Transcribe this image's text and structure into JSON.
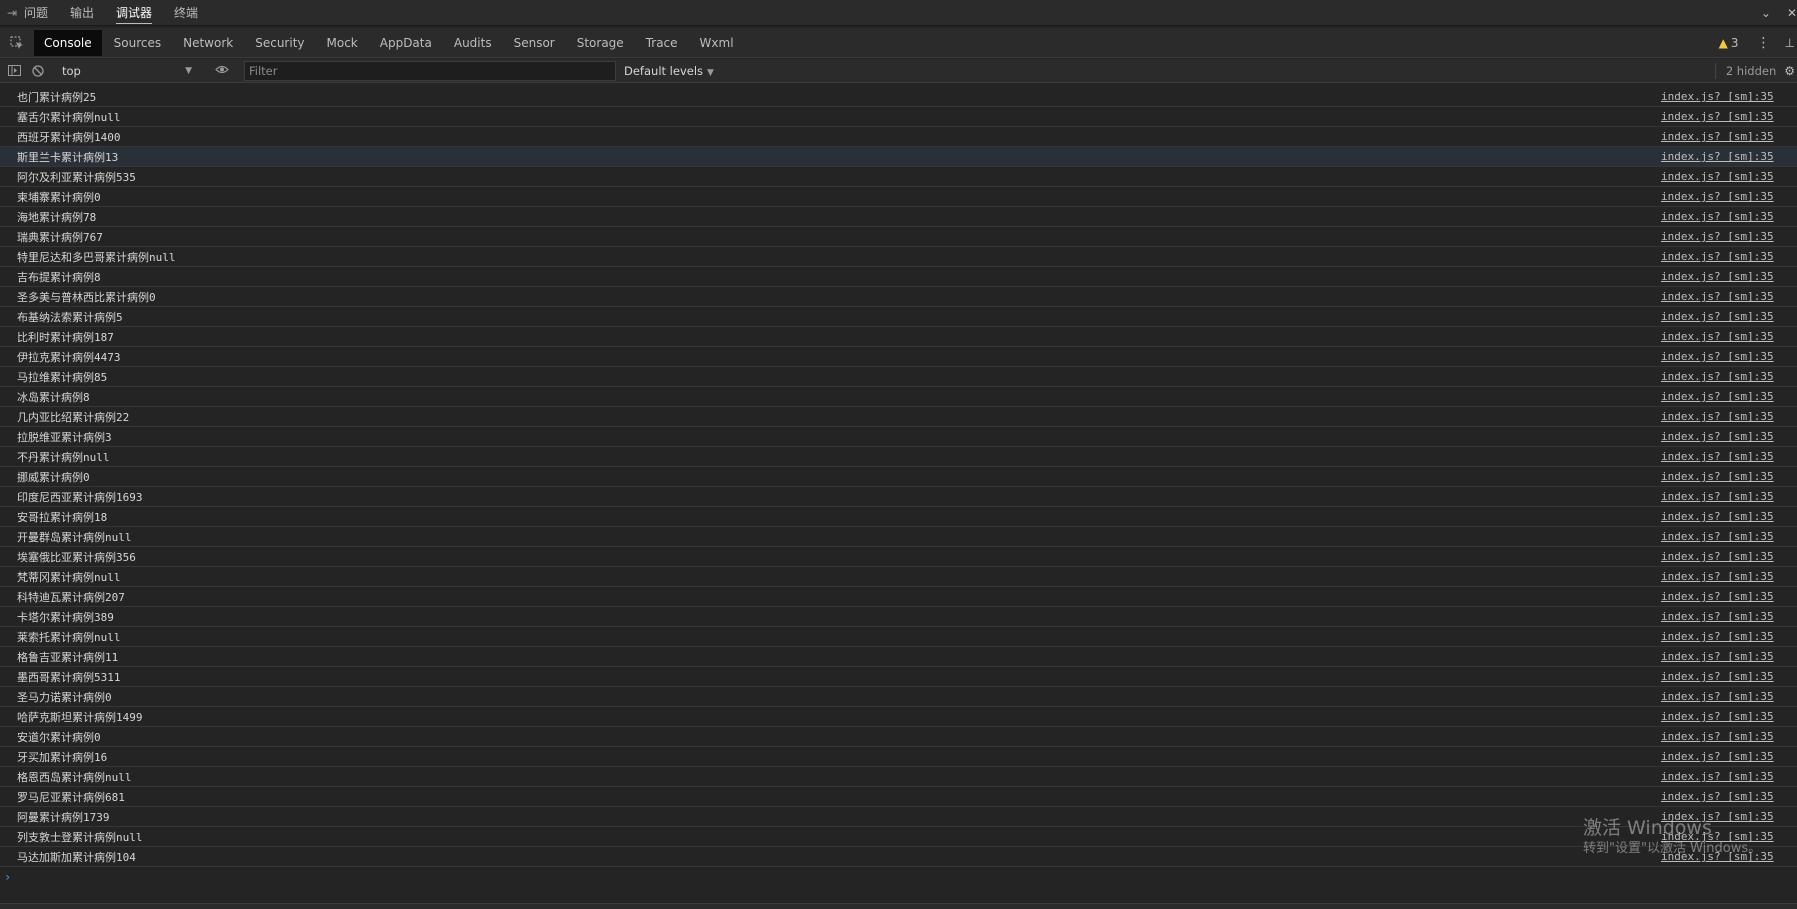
{
  "panel": {
    "toggle_icon": "sidebar-toggle-icon",
    "tabs": [
      "问题",
      "输出",
      "调试器",
      "终端"
    ],
    "active_tab": "调试器",
    "right_icons": [
      "chevron-down-icon",
      "close-icon"
    ]
  },
  "devtools": {
    "tabs": [
      "Console",
      "Sources",
      "Network",
      "Security",
      "Mock",
      "AppData",
      "Audits",
      "Sensor",
      "Storage",
      "Trace",
      "Wxml"
    ],
    "active_tab": "Console",
    "warning_count": "3",
    "more_icon": "kebab-icon"
  },
  "toolbar": {
    "context": "top",
    "filter_placeholder": "Filter",
    "filter_value": "",
    "levels": "Default levels",
    "hidden_count": "2 hidden"
  },
  "console": {
    "source": "index.js? [sm]:35",
    "messages": [
      "也门累计病例25",
      "塞舌尔累计病例null",
      "西班牙累计病例1400",
      "斯里兰卡累计病例13",
      "阿尔及利亚累计病例535",
      "柬埔寨累计病例0",
      "海地累计病例78",
      "瑞典累计病例767",
      "特里尼达和多巴哥累计病例null",
      "吉布提累计病例8",
      "圣多美与普林西比累计病例0",
      "布基纳法索累计病例5",
      "比利时累计病例187",
      "伊拉克累计病例4473",
      "马拉维累计病例85",
      "冰岛累计病例8",
      "几内亚比绍累计病例22",
      "拉脱维亚累计病例3",
      "不丹累计病例null",
      "挪威累计病例0",
      "印度尼西亚累计病例1693",
      "安哥拉累计病例18",
      "开曼群岛累计病例null",
      "埃塞俄比亚累计病例356",
      "梵蒂冈累计病例null",
      "科特迪瓦累计病例207",
      "卡塔尔累计病例389",
      "莱索托累计病例null",
      "格鲁吉亚累计病例11",
      "墨西哥累计病例5311",
      "圣马力诺累计病例0",
      "哈萨克斯坦累计病例1499",
      "安道尔累计病例0",
      "牙买加累计病例16",
      "格恩西岛累计病例null",
      "罗马尼亚累计病例681",
      "阿曼累计病例1739",
      "列支敦士登累计病例null",
      "马达加斯加累计病例104"
    ],
    "highlighted_index": 3,
    "prompt": "›"
  },
  "watermark": {
    "line1": "激活 Windows",
    "line2": "转到\"设置\"以激活 Windows。"
  }
}
